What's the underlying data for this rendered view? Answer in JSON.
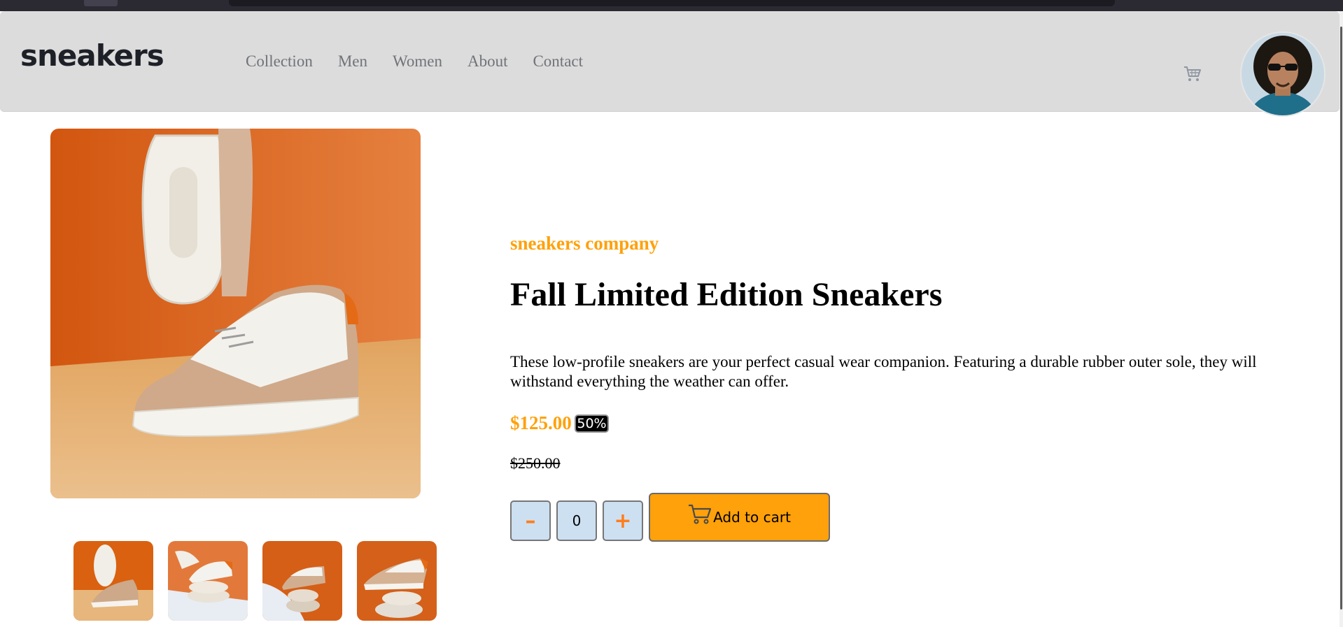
{
  "header": {
    "logo_text": "sneakers",
    "nav": [
      "Collection",
      "Men",
      "Women",
      "About",
      "Contact"
    ],
    "cart_icon": "cart-icon",
    "avatar_icon": "user-avatar"
  },
  "product": {
    "company": "sneakers company",
    "title": "Fall Limited Edition Sneakers",
    "description": "These low-profile sneakers are your perfect casual wear companion. Featuring a durable rubber outer sole, they will withstand everything the weather can offer.",
    "price": "$125.00",
    "discount": "50%",
    "old_price": "$250.00"
  },
  "cart_controls": {
    "minus": "–",
    "quantity": "0",
    "plus": "+",
    "add_label": "Add to cart"
  },
  "colors": {
    "accent": "#ffa10a",
    "header_bg": "#dcdcdc",
    "button_bg": "#cde0f2"
  }
}
